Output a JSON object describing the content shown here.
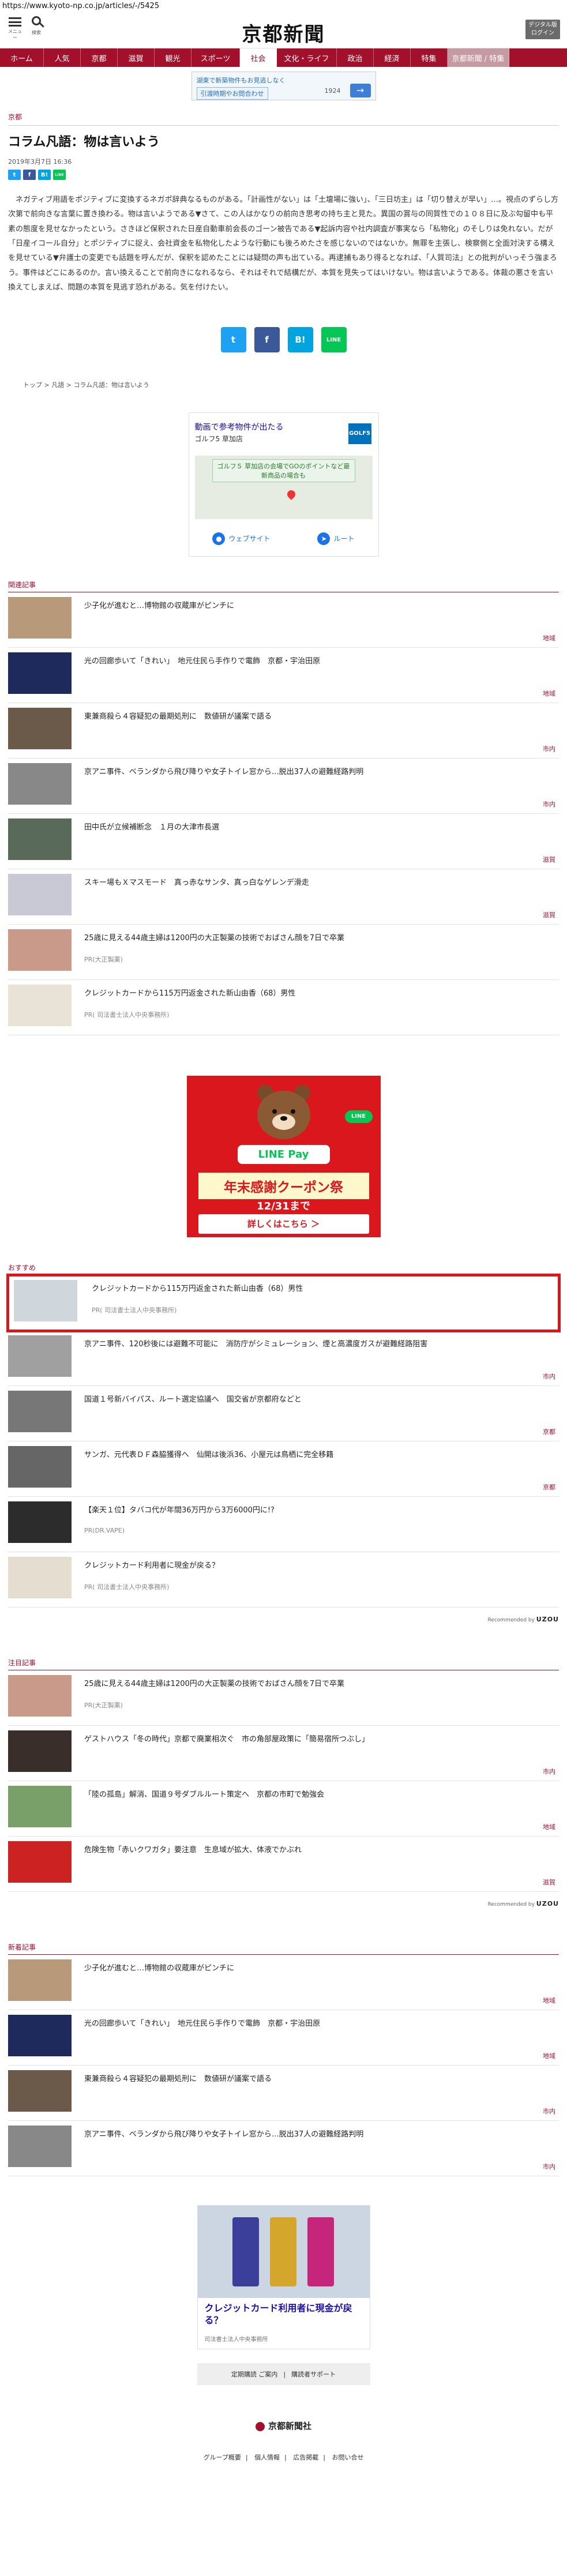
{
  "browser": {
    "url": "https://www.kyoto-np.co.jp/articles/-/5425"
  },
  "header": {
    "menu_label": "メニュー",
    "search_label": "検索",
    "logo": "京都新聞",
    "digital_button": "デジタル版\nログイン"
  },
  "nav": [
    {
      "label": "ホーム"
    },
    {
      "label": "人気"
    },
    {
      "label": "京都"
    },
    {
      "label": "滋賀"
    },
    {
      "label": "観光"
    },
    {
      "label": "スポーツ"
    },
    {
      "label": "社会"
    },
    {
      "label": "文化・ライフ"
    },
    {
      "label": "政治"
    },
    {
      "label": "経済"
    },
    {
      "label": "特集"
    },
    {
      "label": "京都新聞 / 特集"
    }
  ],
  "top_ad": {
    "headline": "湖東で新築物件もお見逃しなく",
    "chip": "引渡時期やお問合わせ",
    "price": "1924",
    "icon_label": "→"
  },
  "article": {
    "category": "京都",
    "title": "コラム凡語：物は言いよう",
    "date": "2019年3月7日 16:36",
    "body": "ネガティブ用語をポジティブに変換するネガポ辞典なるものがある。「計画性がない」は「土壇場に強い」、「三日坊主」は「切り替えが早い」…。視点のずらし方次第で前向きな言葉に置き換わる。物は言いようである▼さて、この人はかなりの前向き思考の持ち主と見た。異国の賞与の同質性での１０８日に及ぶ勾留中も平素の態度を見せなかったという。さきほど保釈された日産自動車前会長のゴーン被告である▼起訴内容や社内調査が事実なら「私物化」のそしりは免れない。だが「日産イコール自分」とポジティブに捉え、会社資金を私物化したような行動にも後ろめたさを感じないのではないか。無罪を主張し、検察側と全面対決する構えを見せている▼弁護士の変更でも話題を呼んだが、保釈を認めたことには疑問の声も出ている。再逮捕もあり得るとなれば、「人質司法」との批判がいっそう強まろう。事件はどこにあるのか。言い換えることで前向きになれるなら、それはそれで結構だが、本質を見失ってはいけない。物は言いようである。体裁の悪さを言い換えてしまえば、問題の本質を見逃す恐れがある。気を付けたい。"
  },
  "share": {
    "twitter": "t",
    "facebook": "f",
    "hatena": "B!",
    "line": "LINE"
  },
  "breadcrumb": [
    "トップ",
    "凡語",
    "コラム凡語：物は言いよう"
  ],
  "map_ad": {
    "headline": "動画で参考物件が出たる",
    "sub": "ゴルフ5 草加店",
    "logo": "GOLF5",
    "note": "ゴルフ５ 草加店の会場でGOのポイントなど最新商品の場合も",
    "website": "ウェブサイト",
    "route": "ルート"
  },
  "related": {
    "title": "関連記事",
    "items": [
      {
        "title": "少子化が進むと…博物館の収蔵庫がピンチに",
        "tag": "地域"
      },
      {
        "title": "光の回廊歩いて「きれい」　地元住民ら手作りで電飾　京都・宇治田原",
        "tag": "地域"
      },
      {
        "title": "東兼商殺ら４容疑犯の最期処刑に　数値研が議案で語る",
        "tag": "市内"
      },
      {
        "title": "京アニ事件、ベランダから飛び降りや女子トイレ窓から…脱出37人の避難経路判明",
        "tag": "市内"
      },
      {
        "title": "田中氏が立候補断念　１月の大津市長選",
        "tag": "滋賀"
      },
      {
        "title": "スキー場もＸマスモード　真っ赤なサンタ、真っ白なゲレンデ滑走",
        "tag": "滋賀"
      },
      {
        "title": "25歳に見える44歳主婦は1200円の大正製薬の技術でおばさん顔を7日で卒業",
        "pr": "PR(大正製薬)"
      },
      {
        "title": "クレジットカードから115万円返金された新山由香（68）男性",
        "pr": "PR( 司法書士法人中央事務所)"
      }
    ]
  },
  "line_ad": {
    "badge": "LINE",
    "brand": "LINE Pay",
    "message": "年末感謝クーポン祭",
    "date": "12/31まで",
    "cta": "詳しくはこちら ＞"
  },
  "recommend": {
    "title": "おすすめ",
    "items": [
      {
        "title": "クレジットカードから115万円返金された新山由香（68）男性",
        "pr": "PR( 司法書士法人中央事務所)"
      },
      {
        "title": "京アニ事件、120秒後には避難不可能に　消防庁がシミュレーション、煙と高濃度ガスが避難経路阻害",
        "tag": "市内"
      },
      {
        "title": "国道１号新バイパス、ルート選定協議へ　国交省が京都府などと",
        "tag": "京都"
      },
      {
        "title": "サンガ、元代表ＤＦ森脇獲得へ　仙開は後浜36、小屋元は鳥栖に完全移籍",
        "tag": "京都"
      },
      {
        "title": "【楽天１位】タバコ代が年間36万円から3万6000円に!?",
        "pr": "PR(DR.VAPE)"
      },
      {
        "title": "クレジットカード利用者に現金が戻る？",
        "pr": "PR( 司法書士法人中央事務所)"
      }
    ],
    "recommended_by": "Recommended by",
    "recommended_brand": "UZOU"
  },
  "attention": {
    "title": "注目記事",
    "items": [
      {
        "title": "25歳に見える44歳主婦は1200円の大正製薬の技術でおばさん顔を7日で卒業",
        "pr": "PR(大正製薬)"
      },
      {
        "title": "ゲストハウス「冬の時代」京都で廃業相次ぐ　市の角部屋政策に「簡易宿所つぶし」",
        "tag": "市内"
      },
      {
        "title": "「陸の孤島」解消、国道９号ダブルルート策定へ　京都の市町で勉強会",
        "tag": "地域"
      },
      {
        "title": "危険生物「赤いクワガタ」要注意　生息域が拡大、体液でかぶれ",
        "tag": "滋賀"
      }
    ],
    "recommended_by": "Recommended by",
    "recommended_brand": "UZOU"
  },
  "newest": {
    "title": "新着記事",
    "items": [
      {
        "title": "少子化が進むと…博物館の収蔵庫がピンチに",
        "tag": "地域"
      },
      {
        "title": "光の回廊歩いて「きれい」　地元住民ら手作りで電飾　京都・宇治田原",
        "tag": "地域"
      },
      {
        "title": "東兼商殺ら４容疑犯の最期処刑に　数値研が議案で語る",
        "tag": "市内"
      },
      {
        "title": "京アニ事件、ベランダから飛び降りや女子トイレ窓から…脱出37人の避難経路判明",
        "tag": "市内"
      }
    ]
  },
  "card_ad": {
    "headline": "クレジットカード利用者に現金が戻る？",
    "source": "司法書士法人中央事務所"
  },
  "bottom_links": [
    "定期購読 ご案内",
    "購読者サポート"
  ],
  "footer": {
    "logo": "京都新聞社",
    "links": [
      "グループ概要",
      "個人情報",
      "広告掲載",
      "お問い合せ"
    ]
  },
  "colors": {
    "brand": "#a3102c",
    "highlight": "#d9171c",
    "twitter": "#1da1f2",
    "facebook": "#3b5998",
    "hatena": "#00a4de",
    "line": "#06c755"
  }
}
